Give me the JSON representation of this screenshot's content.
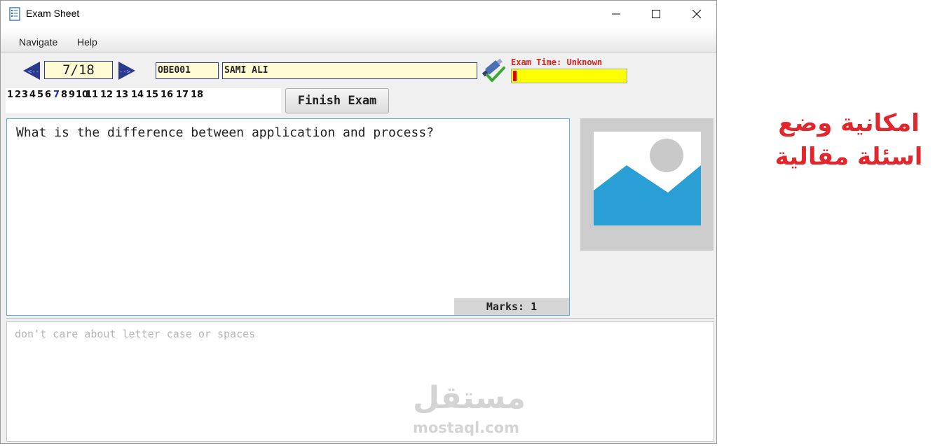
{
  "window": {
    "title": "Exam Sheet",
    "icons": {
      "app": "checklist-icon",
      "minimize": "minimize-icon",
      "maximize": "maximize-icon",
      "close": "close-icon"
    }
  },
  "menu": {
    "navigate": "Navigate",
    "help": "Help"
  },
  "toolbar": {
    "page_indicator": "7/18",
    "prev_label": "<--",
    "next_label": "-->",
    "student_id": "OBE001",
    "student_name": "SAMI ALI",
    "exam_time_label": "Exam Time: Unknown",
    "time_progress": 0.02,
    "status_icon": "usb-check-icon"
  },
  "question_numbers": {
    "items": [
      "1",
      "2",
      "3",
      "4",
      "5",
      "6",
      "7",
      "8",
      "9",
      "10",
      "11",
      "12",
      "13",
      "14",
      "15",
      "16",
      "17",
      "18"
    ],
    "current": "7"
  },
  "finish_button": "Finish Exam",
  "question": {
    "text": "What is the difference between application and process?",
    "marks": "Marks: 1",
    "image_icon": "image-placeholder-icon"
  },
  "answer": {
    "placeholder": "don't care about letter case or spaces"
  },
  "watermark": {
    "arabic": "مستقل",
    "latin": "mostaql.com"
  },
  "caption": {
    "line1": "امكانية وضع",
    "line2": "اسئلة مقالية"
  },
  "colors": {
    "accent_blue": "#2b3a8f",
    "field_background": "#fffbd4",
    "time_bar": "#ffff00",
    "alert_red": "#e02020",
    "question_border": "#5ab4de",
    "image_blue": "#2a9fd6",
    "caption_red": "#e3262c"
  }
}
